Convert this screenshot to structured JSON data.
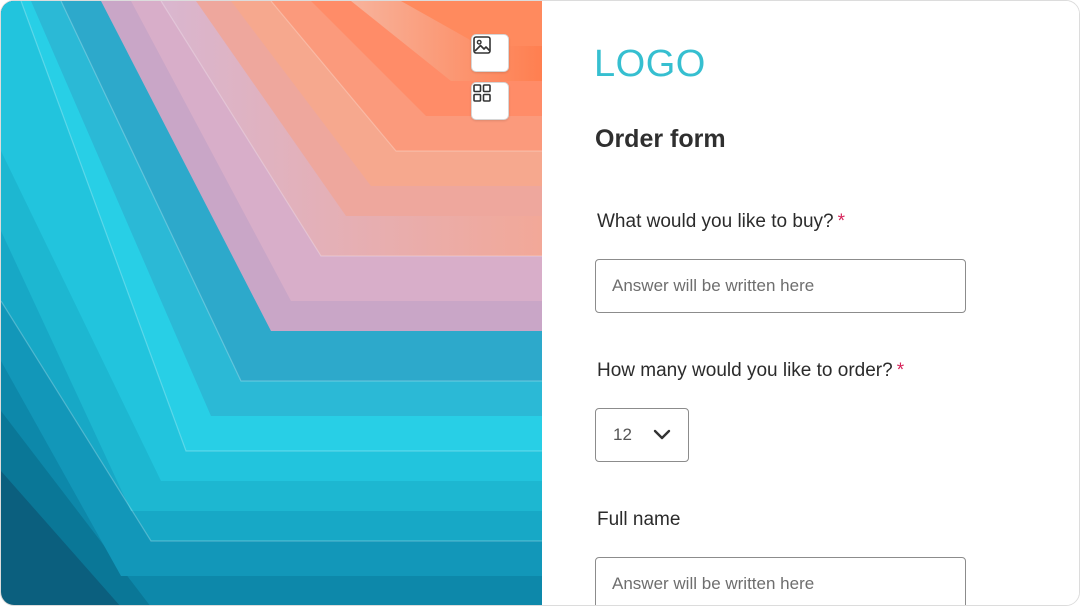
{
  "toolbar": {
    "image_icon": "image-icon",
    "layout_icon": "layout-grid-icon"
  },
  "form": {
    "logo_text": "LOGO",
    "title": "Order form",
    "questions": [
      {
        "label": "What would you like to buy?",
        "required_mark": "*",
        "type": "text",
        "placeholder": "Answer will be written here"
      },
      {
        "label": "How many would you like to order?",
        "required_mark": "*",
        "type": "select",
        "selected_value": "12"
      },
      {
        "label": "Full name",
        "type": "text",
        "placeholder": "Answer will be written here"
      }
    ]
  },
  "colors": {
    "logo": "#36bfd0",
    "required": "#d6245a"
  }
}
